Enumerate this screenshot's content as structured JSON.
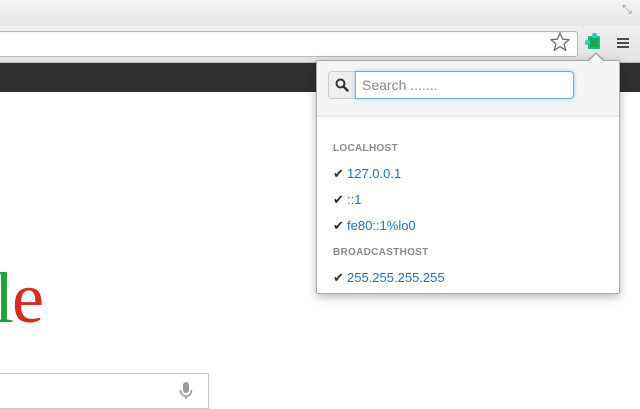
{
  "browser": {
    "bookmark_icon": "star-icon",
    "extension_icon": "puzzle-extension-icon",
    "menu_icon": "hamburger-menu-icon",
    "restore_icon": "restore-window-icon"
  },
  "page": {
    "logo_l": "l",
    "logo_e": "e",
    "mic_icon": "microphone-icon"
  },
  "popup": {
    "search": {
      "placeholder": "Search ......."
    },
    "groups": [
      {
        "title": "LOCALHOST",
        "items": [
          "127.0.0.1",
          "::1",
          "fe80::1%lo0"
        ]
      },
      {
        "title": "BROADCASTHOST",
        "items": [
          "255.255.255.255"
        ]
      }
    ],
    "check_glyph": "✔"
  },
  "colors": {
    "link": "#2a6fa8",
    "focus_border": "#66afe9",
    "bookmark_bar": "#2f2f2f"
  }
}
